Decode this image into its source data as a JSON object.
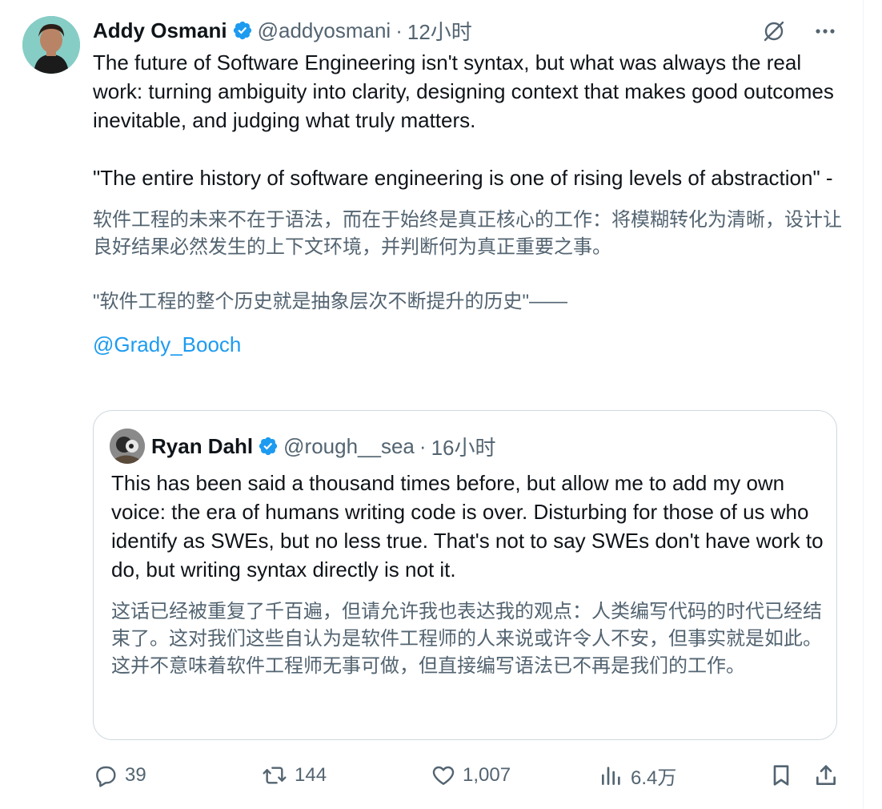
{
  "tweet": {
    "author": {
      "name": "Addy Osmani",
      "handle": "@addyosmani",
      "time": "12小时"
    },
    "separator": "·",
    "text_en_1": "The future of Software Engineering isn't syntax, but what was always the real work: turning ambiguity into clarity, designing context that makes good outcomes inevitable, and judging what truly matters.",
    "text_en_2": "\"The entire history of software engineering is one of rising levels of abstraction\" -",
    "text_cn_1": "软件工程的未来不在于语法，而在于始终是真正核心的工作：将模糊转化为清晰，设计让良好结果必然发生的上下文环境，并判断何为真正重要之事。",
    "text_cn_2": "\"软件工程的整个历史就是抽象层次不断提升的历史\"——",
    "mention": "@Grady_Booch"
  },
  "quote": {
    "author": {
      "name": "Ryan Dahl",
      "handle": "@rough__sea",
      "time": "16小时"
    },
    "separator": "·",
    "text_en": "This has been said a thousand times before, but allow me to add my own voice: the era of humans writing code is over. Disturbing for those of us who identify as SWEs, but no less true. That's not to say SWEs don't have work to do, but writing syntax directly is not it.",
    "text_cn": "这话已经被重复了千百遍，但请允许我也表达我的观点：人类编写代码的时代已经结束了。这对我们这些自认为是软件工程师的人来说或许令人不安，但事实就是如此。这并不意味着软件工程师无事可做，但直接编写语法已不再是我们的工作。"
  },
  "actions": {
    "replies": "39",
    "retweets": "144",
    "likes": "1,007",
    "views": "6.4万"
  },
  "icons": {
    "verified": "verified-badge-icon",
    "grok": "grok-icon",
    "more": "more-icon",
    "reply": "reply-icon",
    "retweet": "retweet-icon",
    "like": "heart-icon",
    "views": "views-icon",
    "bookmark": "bookmark-icon",
    "share": "share-icon"
  },
  "colors": {
    "accent": "#1d9bf0",
    "secondary_text": "#536471",
    "border": "#cfd9de"
  }
}
